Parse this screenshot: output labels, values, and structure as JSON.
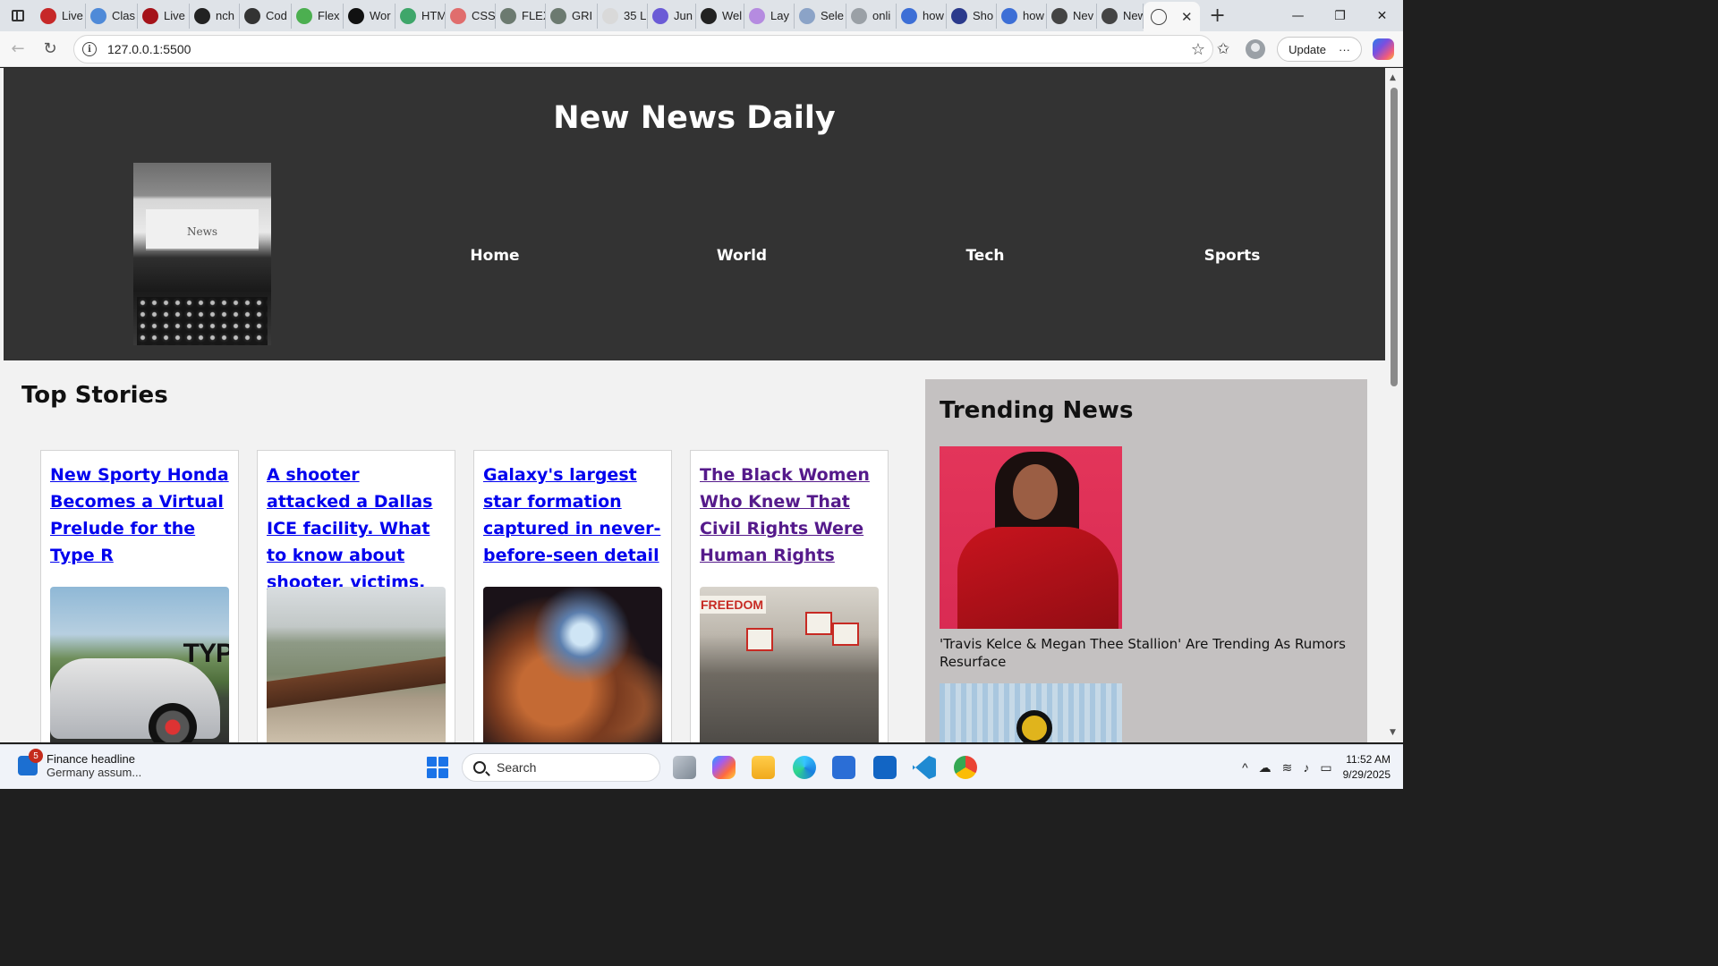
{
  "browser": {
    "tabs": [
      {
        "label": "Live",
        "icon": "ct-icon",
        "color": "#c62828"
      },
      {
        "label": "Clas",
        "icon": "classroom-icon",
        "color": "#4f8ad8"
      },
      {
        "label": "Live",
        "icon": "ct-icon",
        "color": "#a5131a"
      },
      {
        "label": "nch",
        "icon": "github-icon",
        "color": "#222222"
      },
      {
        "label": "Cod",
        "icon": "openai-icon",
        "color": "#333333"
      },
      {
        "label": "Flex",
        "icon": "frog-icon",
        "color": "#4caf50"
      },
      {
        "label": "Wor",
        "icon": "wordpress-icon",
        "color": "#111111"
      },
      {
        "label": "HTM",
        "icon": "w3-icon",
        "color": "#3fa66a"
      },
      {
        "label": "CSS",
        "icon": "asterisk-icon",
        "color": "#e06d6d"
      },
      {
        "label": "FLEX",
        "icon": "grid-icon",
        "color": "#6c7a70"
      },
      {
        "label": "GRI",
        "icon": "grid-icon",
        "color": "#6c7a70"
      },
      {
        "label": "35 L",
        "icon": "doc-icon",
        "color": "#d9d9d9"
      },
      {
        "label": "Jun",
        "icon": "circle-icon",
        "color": "#6b5bd6"
      },
      {
        "label": "Wel",
        "icon": "b-icon",
        "color": "#222222"
      },
      {
        "label": "Lay",
        "icon": "b-icon",
        "color": "#b58be0"
      },
      {
        "label": "Sele",
        "icon": "puzzle-icon",
        "color": "#8ba3c7"
      },
      {
        "label": "onli",
        "icon": "search-icon",
        "color": "#9aa0a6"
      },
      {
        "label": "how",
        "icon": "search-icon",
        "color": "#3d6fd6"
      },
      {
        "label": "Sho",
        "icon": "m-icon",
        "color": "#2b3a8c"
      },
      {
        "label": "how",
        "icon": "search-icon",
        "color": "#3d6fd6"
      },
      {
        "label": "Nev",
        "icon": "globe-icon",
        "color": "#444444"
      },
      {
        "label": "New",
        "icon": "globe-icon",
        "color": "#444444"
      }
    ],
    "active_tab": {
      "icon": "globe-icon"
    },
    "new_tab_label": "+",
    "url": "127.0.0.1:5500",
    "update_label": "Update",
    "more_label": "···"
  },
  "site": {
    "title": "New News Daily",
    "logo_text": "News",
    "nav": [
      "Home",
      "World",
      "Tech",
      "Sports"
    ],
    "top_stories_heading": "Top Stories",
    "stories": [
      {
        "headline": "New Sporty Honda Becomes a Virtual Prelude for the Type R",
        "visited": false,
        "image": "honda-car"
      },
      {
        "headline": "A shooter attacked a Dallas ICE facility. What to know about shooter, victims.",
        "visited": false,
        "image": "border-desert"
      },
      {
        "headline": "Galaxy's largest star formation captured in never-before-seen detail",
        "visited": false,
        "image": "nebula"
      },
      {
        "headline": "The Black Women Who Knew That Civil Rights Were Human Rights",
        "visited": true,
        "image": "civil-rights-march"
      }
    ],
    "car_badge_text": "TYP",
    "march_sign_text": "FREEDOM",
    "trending_heading": "Trending News",
    "trending": [
      {
        "caption": "'Travis Kelce & Megan Thee Stallion' Are Trending As Rumors Resurface",
        "image": "portrait-red-jacket"
      },
      {
        "caption": "",
        "image": "football-player"
      }
    ]
  },
  "colors": {
    "header_bg": "#333333",
    "page_bg": "#f2f2f2",
    "trending_bg": "#c4c1c1",
    "link": "#0000ee",
    "link_visited": "#551a8b"
  },
  "taskbar": {
    "widget_title": "Finance headline",
    "widget_subtitle": "Germany assum...",
    "widget_badge": "5",
    "search_label": "Search",
    "time": "11:52 AM",
    "date": "9/29/2025"
  }
}
